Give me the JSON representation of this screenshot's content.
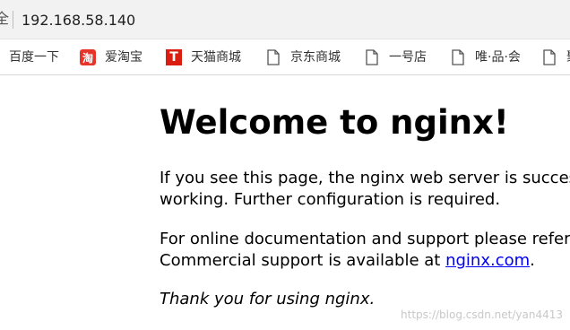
{
  "address_bar": {
    "left_glyph": "全",
    "url": "192.168.58.140"
  },
  "bookmarks": [
    {
      "label": "百度一下",
      "icon": "none"
    },
    {
      "label": "爱淘宝",
      "icon": "taobao-icon",
      "glyph": "淘"
    },
    {
      "label": "天猫商城",
      "icon": "tmall-icon",
      "glyph": "T"
    },
    {
      "label": "京东商城",
      "icon": "page-icon"
    },
    {
      "label": "一号店",
      "icon": "page-icon"
    },
    {
      "label": "唯·品·会",
      "icon": "page-icon"
    },
    {
      "label": "聚",
      "icon": "page-icon"
    }
  ],
  "page": {
    "heading": "Welcome to nginx!",
    "paragraph1": {
      "line1": "If you see this page, the nginx web server is successfully installed and",
      "line2": "working. Further configuration is required."
    },
    "paragraph2": {
      "line1": "For online documentation and support please refer to nginx.org.",
      "line2_prefix": "Commercial support is available at ",
      "line2_link": "nginx.com",
      "line2_suffix": "."
    },
    "paragraph3": "Thank you for using nginx."
  },
  "watermark": "https://blog.csdn.net/yan4413"
}
